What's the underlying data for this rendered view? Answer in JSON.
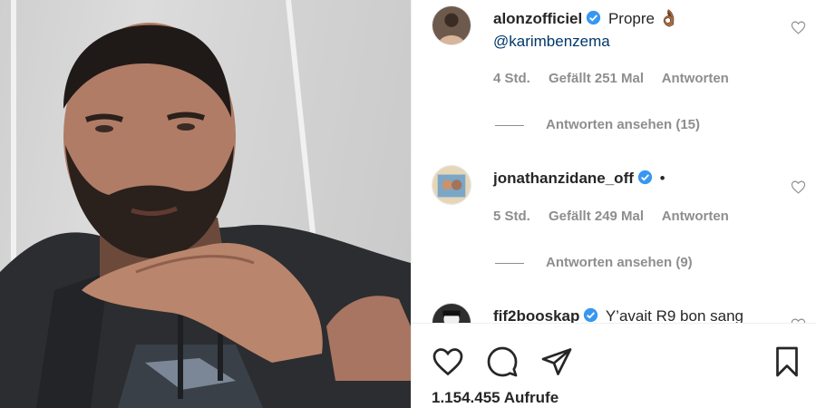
{
  "comments": [
    {
      "username": "alonzofficiel",
      "text": "Propre",
      "emoji": "👌🏾",
      "mention": "@karimbenzema",
      "time": "4 Std.",
      "likes": "Gefällt 251 Mal",
      "reply": "Antworten",
      "view_replies": "Antworten ansehen (15)"
    },
    {
      "username": "jonathanzidane_off",
      "text": "•",
      "time": "5 Std.",
      "likes": "Gefällt 249 Mal",
      "reply": "Antworten",
      "view_replies": "Antworten ansehen (9)"
    },
    {
      "username": "fif2booskap",
      "text": "Y’avait R9 bon sang"
    }
  ],
  "views": "1.154.455 Aufrufe",
  "icons": {
    "like": "heart-icon",
    "comment": "comment-bubble-icon",
    "share": "paper-plane-icon",
    "save": "bookmark-icon",
    "verified": "verified-badge-icon"
  },
  "colors": {
    "verified": "#3897f0",
    "mention": "#00376b",
    "meta": "#8e8e8e"
  }
}
